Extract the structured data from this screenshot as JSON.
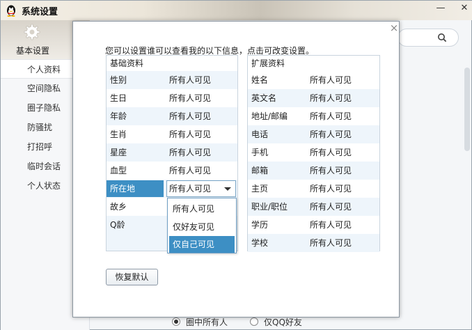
{
  "window": {
    "title": "系统设置",
    "min_glyph": "—",
    "max_glyph": "□",
    "close_glyph": "✕"
  },
  "sidebar": {
    "header_label": "基本设置",
    "items": [
      {
        "label": "个人资料",
        "active": true
      },
      {
        "label": "空间隐私"
      },
      {
        "label": "圈子隐私"
      },
      {
        "label": "防骚扰"
      },
      {
        "label": "打招呼"
      },
      {
        "label": "临时会话"
      },
      {
        "label": "个人状态"
      }
    ]
  },
  "bottom_radios": [
    {
      "label": "圈中所有人",
      "checked": true
    },
    {
      "label": "仅QQ好友",
      "checked": false
    }
  ],
  "dialog": {
    "close_glyph": "×",
    "description": "您可以设置谁可以查看我的以下信息，点击可改变设置。",
    "restore_button": "恢复默认",
    "basic": {
      "header": "基础资料",
      "rows": [
        {
          "field": "性别",
          "value": "所有人可见"
        },
        {
          "field": "生日",
          "value": "所有人可见"
        },
        {
          "field": "年龄",
          "value": "所有人可见"
        },
        {
          "field": "生肖",
          "value": "所有人可见"
        },
        {
          "field": "星座",
          "value": "所有人可见"
        },
        {
          "field": "血型",
          "value": "所有人可见"
        },
        {
          "field": "所在地",
          "value": "所有人可见",
          "editing": true
        },
        {
          "field": "故乡",
          "value": ""
        },
        {
          "field": "Q龄",
          "value": ""
        }
      ]
    },
    "extended": {
      "header": "扩展资料",
      "rows": [
        {
          "field": "姓名",
          "value": "所有人可见"
        },
        {
          "field": "英文名",
          "value": "所有人可见"
        },
        {
          "field": "地址/邮编",
          "value": "所有人可见"
        },
        {
          "field": "电话",
          "value": "所有人可见"
        },
        {
          "field": "手机",
          "value": "所有人可见"
        },
        {
          "field": "邮箱",
          "value": "所有人可见"
        },
        {
          "field": "主页",
          "value": "所有人可见"
        },
        {
          "field": "职业/职位",
          "value": "所有人可见"
        },
        {
          "field": "学历",
          "value": "所有人可见"
        },
        {
          "field": "学校",
          "value": "所有人可见"
        }
      ]
    },
    "dropdown_options": [
      {
        "label": "所有人可见"
      },
      {
        "label": "仅好友可见"
      },
      {
        "label": "仅自己可见",
        "highlighted": true
      }
    ]
  },
  "colors": {
    "accent": "#3d8fc4",
    "row_alt": "#eef5fb",
    "panel_border": "#c9d4de"
  },
  "icons": [
    "qq-penguin-icon",
    "gear-icon",
    "search-icon",
    "minimize-icon",
    "maximize-icon",
    "close-icon",
    "chevron-down-icon"
  ]
}
